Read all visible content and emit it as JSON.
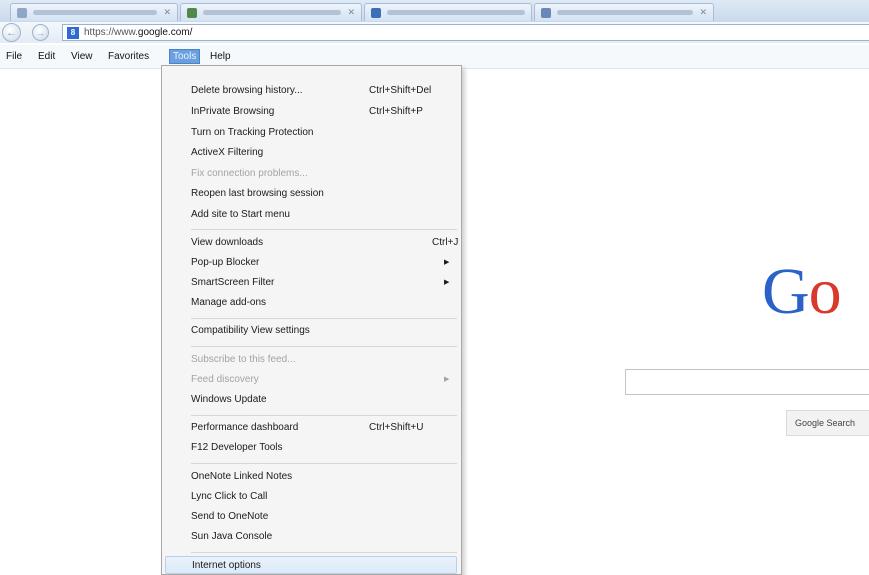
{
  "address_bar": {
    "url_prefix": "https://www.",
    "url_domain": "google.com/"
  },
  "menu_bar": {
    "file": "File",
    "edit": "Edit",
    "view": "View",
    "favorites": "Favorites",
    "tools": "Tools",
    "help": "Help"
  },
  "tools_menu": {
    "items": [
      {
        "label": "Delete browsing history...",
        "shortcut": "Ctrl+Shift+Del"
      },
      {
        "label": "InPrivate Browsing",
        "shortcut": "Ctrl+Shift+P"
      },
      {
        "label": "Turn on Tracking Protection"
      },
      {
        "label": "ActiveX Filtering"
      },
      {
        "label": "Fix connection problems..."
      },
      {
        "label": "Reopen last browsing session"
      },
      {
        "label": "Add site to Start menu"
      },
      {
        "label": "View downloads",
        "shortcut": "Ctrl+J"
      },
      {
        "label": "Pop-up Blocker"
      },
      {
        "label": "SmartScreen Filter"
      },
      {
        "label": "Manage add-ons"
      },
      {
        "label": "Compatibility View settings"
      },
      {
        "label": "Subscribe to this feed..."
      },
      {
        "label": "Feed discovery"
      },
      {
        "label": "Windows Update"
      },
      {
        "label": "Performance dashboard",
        "shortcut": "Ctrl+Shift+U"
      },
      {
        "label": "F12 Developer Tools"
      },
      {
        "label": "OneNote Linked Notes"
      },
      {
        "label": "Lync Click to Call"
      },
      {
        "label": "Send to OneNote"
      },
      {
        "label": "Sun Java Console"
      },
      {
        "label": "Internet options"
      }
    ]
  },
  "google": {
    "logo_g": "G",
    "logo_o": "o",
    "search_button": "Google Search"
  },
  "colors": {
    "menu_highlight": "#6aa0e0",
    "google_blue": "#2a62c8",
    "google_red": "#d8392b"
  }
}
